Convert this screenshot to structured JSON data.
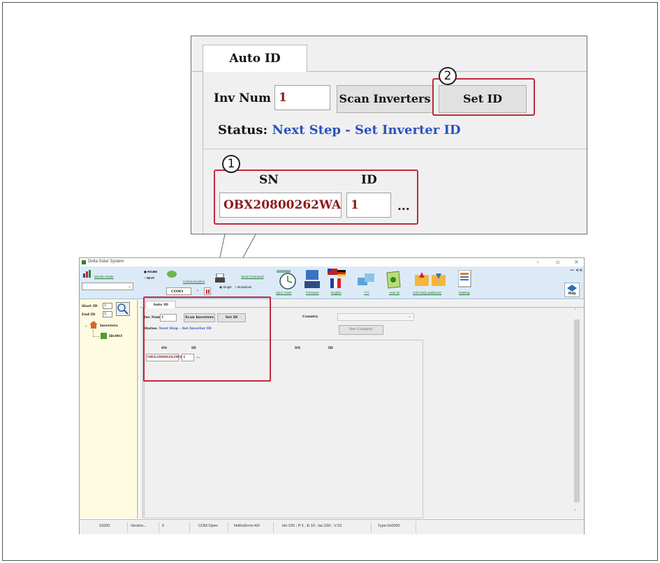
{
  "callout": {
    "tab_label": "Auto ID",
    "inv_num_label": "Inv Num",
    "inv_num_value": "1",
    "scan_button": "Scan Inverters",
    "set_id_button": "Set ID",
    "status_label": "Status:",
    "status_value": "Next Step - Set Inverter ID",
    "sn_header": "SN",
    "id_header": "ID",
    "sn_value": "OBX20800262WA",
    "id_value": "1",
    "more": "...",
    "marker_1": "1",
    "marker_2": "2"
  },
  "app": {
    "title": "Delta Solar System",
    "toolbar": {
      "monitor_mode": "Monitor Mode",
      "rs485": "RS485",
      "wifi": "Wi-Fi",
      "communication": "Communication",
      "com_port": "COM3",
      "send_command": "Send Command",
      "single": "Single",
      "broadcast": "Broadcast",
      "sync_clock": "Sync Clock",
      "firmware": "Firmware",
      "english": "English",
      "ppt": "???",
      "auto_id": "Auto ID",
      "grid_set": "Grid Set(Load/Save)",
      "datalog": "Datalog",
      "help": "Help",
      "collapse": "<<"
    },
    "sidebar": {
      "start_id_label": "Start ID",
      "start_id_value": "1",
      "end_id_label": "End ID",
      "end_id_value": "5",
      "tree_root": "Inverters",
      "tree_child": "ID:003"
    },
    "main": {
      "tab_label": "Auto ID",
      "inv_num_label": "Inv Num",
      "inv_num_value": "1",
      "scan_button": "Scan Inverters",
      "set_id_button": "Set ID",
      "status_label": "Status:",
      "status_value": "Next Step - Set Inverter ID",
      "sn_header": "SN",
      "id_header": "ID",
      "sn_header_2": "SN",
      "id_header_2": "ID",
      "sn_value": "OBX20800262WA",
      "id_value": "1",
      "more": "...",
      "country_label": "Country",
      "set_country_button": "Set Country"
    },
    "statusbar": {
      "baud": "19200",
      "version": "Version...",
      "count": "5",
      "com_state": "COM Open",
      "norx": "NoRx/Error:4/0",
      "readings": "Idc:100 ; P:1 ; E:10 ; Iac:100 ; V:10",
      "type": "Type:0x0000"
    }
  },
  "colors": {
    "highlight_red": "#c0283a",
    "status_blue": "#2a52be",
    "value_dark_red": "#8b1a1a",
    "toolbar_bg": "#dceaf7",
    "sidebar_bg": "#fffbe1"
  }
}
